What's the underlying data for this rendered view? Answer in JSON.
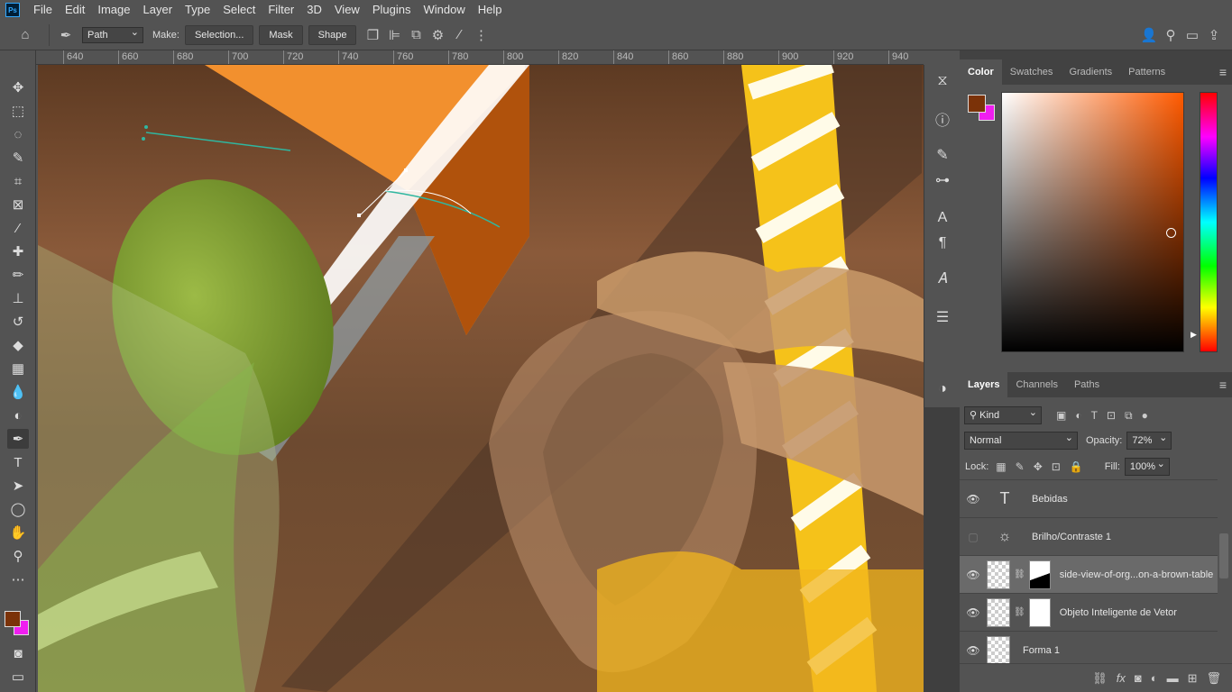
{
  "menubar": {
    "logo": "Ps",
    "items": [
      "File",
      "Edit",
      "Image",
      "Layer",
      "Type",
      "Select",
      "Filter",
      "3D",
      "View",
      "Plugins",
      "Window",
      "Help"
    ]
  },
  "options": {
    "path_mode": "Path",
    "make_label": "Make:",
    "buttons": [
      "Selection...",
      "Mask",
      "Shape"
    ]
  },
  "ruler": {
    "ticks": [
      "640",
      "660",
      "680",
      "700",
      "720",
      "740",
      "760",
      "780",
      "800",
      "820",
      "840",
      "860",
      "880",
      "900",
      "920",
      "940"
    ]
  },
  "toolbar": {
    "tools": [
      {
        "name": "move-tool",
        "icon": "✥"
      },
      {
        "name": "marquee-tool",
        "icon": "⬚"
      },
      {
        "name": "lasso-tool",
        "icon": "◌"
      },
      {
        "name": "quick-selection-tool",
        "icon": "✎"
      },
      {
        "name": "crop-tool",
        "icon": "⌗"
      },
      {
        "name": "frame-tool",
        "icon": "⊠"
      },
      {
        "name": "eyedropper-tool",
        "icon": "⁄"
      },
      {
        "name": "healing-tool",
        "icon": "✚"
      },
      {
        "name": "brush-tool",
        "icon": "✏"
      },
      {
        "name": "stamp-tool",
        "icon": "⊥"
      },
      {
        "name": "history-brush-tool",
        "icon": "↺"
      },
      {
        "name": "eraser-tool",
        "icon": "◆"
      },
      {
        "name": "gradient-tool",
        "icon": "▦"
      },
      {
        "name": "blur-tool",
        "icon": "💧"
      },
      {
        "name": "dodge-tool",
        "icon": "◐"
      },
      {
        "name": "pen-tool",
        "icon": "✒"
      },
      {
        "name": "type-tool",
        "icon": "T"
      },
      {
        "name": "path-selection-tool",
        "icon": "➤"
      },
      {
        "name": "ellipse-tool",
        "icon": "◯"
      },
      {
        "name": "hand-tool",
        "icon": "✋"
      },
      {
        "name": "zoom-tool",
        "icon": "⚲"
      },
      {
        "name": "more-tools",
        "icon": "⋯"
      }
    ]
  },
  "color_panel": {
    "tabs": [
      "Color",
      "Swatches",
      "Gradients",
      "Patterns"
    ],
    "foreground": "#7b3208",
    "background": "#f01ef0"
  },
  "layers_panel": {
    "tabs": [
      "Layers",
      "Channels",
      "Paths"
    ],
    "filter_kind": "Kind",
    "blend_mode": "Normal",
    "opacity_label": "Opacity:",
    "opacity_value": "72%",
    "lock_label": "Lock:",
    "fill_label": "Fill:",
    "fill_value": "100%",
    "layers": [
      {
        "name": "Bebidas",
        "type": "text",
        "visible": true
      },
      {
        "name": "Brilho/Contraste 1",
        "type": "adjustment",
        "visible": false
      },
      {
        "name": "side-view-of-org...on-a-brown-table",
        "type": "smart",
        "visible": true,
        "selected": true
      },
      {
        "name": "Objeto Inteligente de Vetor",
        "type": "smart",
        "visible": true
      },
      {
        "name": "Forma 1",
        "type": "shape",
        "visible": true
      }
    ]
  }
}
